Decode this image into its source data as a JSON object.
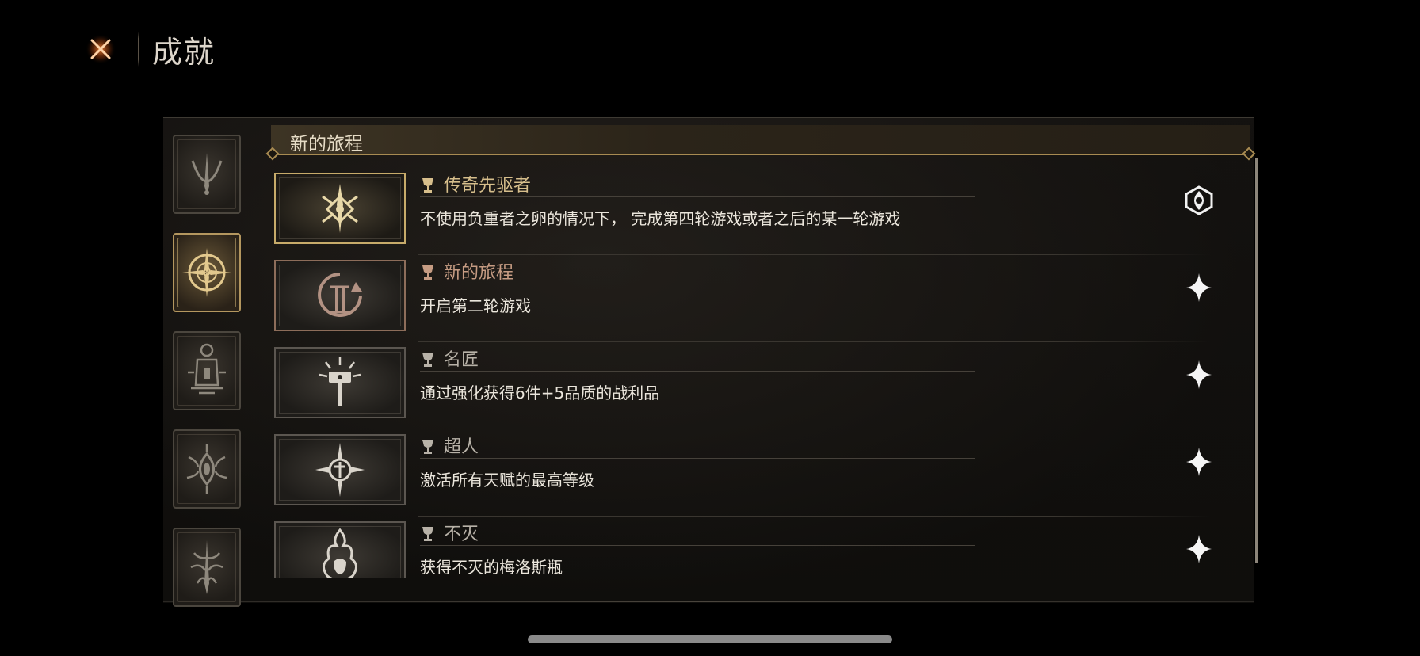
{
  "header": {
    "title": "成就",
    "close_icon": "close-x-icon"
  },
  "categories": [
    {
      "icon": "crescent-spike-emblem-icon",
      "active": false
    },
    {
      "icon": "compass-star-emblem-icon",
      "active": true
    },
    {
      "icon": "lantern-emblem-icon",
      "active": false
    },
    {
      "icon": "thorned-eye-emblem-icon",
      "active": false
    },
    {
      "icon": "sword-root-emblem-icon",
      "active": false
    }
  ],
  "section": {
    "title": "新的旅程"
  },
  "achievements": [
    {
      "title": "传奇先驱者",
      "description": "不使用负重者之卵的情况下， 完成第四轮游戏或者之后的某一轮游戏",
      "tier": "gold",
      "badge_icon": "radiant-rune-icon",
      "status_icon": "claimed-emblem-icon"
    },
    {
      "title": "新的旅程",
      "description": "开启第二轮游戏",
      "tier": "bronze",
      "badge_icon": "cycle-two-icon",
      "status_icon": "sparkle-star-icon"
    },
    {
      "title": "名匠",
      "description": "通过强化获得6件+5品质的战利品",
      "tier": "silver",
      "badge_icon": "forge-hammer-icon",
      "status_icon": "sparkle-star-icon"
    },
    {
      "title": "超人",
      "description": "激活所有天赋的最高等级",
      "tier": "silver",
      "badge_icon": "star-orb-icon",
      "status_icon": "sparkle-star-icon"
    },
    {
      "title": "不灭",
      "description": "获得不灭的梅洛斯瓶",
      "tier": "silver",
      "badge_icon": "flame-flask-icon",
      "status_icon": "sparkle-star-icon"
    }
  ],
  "colors": {
    "gold": "#d7bf8c",
    "bronze": "#c69c83",
    "silver": "#b8b2a8",
    "accent_frame": "#a88b52"
  }
}
